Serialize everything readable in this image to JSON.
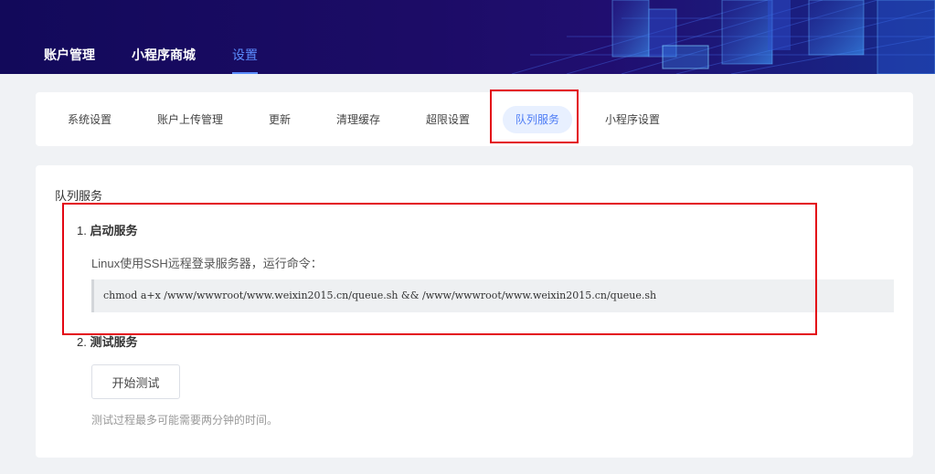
{
  "header": {
    "nav": [
      {
        "label": "账户管理"
      },
      {
        "label": "小程序商城"
      },
      {
        "label": "设置"
      }
    ],
    "active_index": 2,
    "accent_color": "#5b8cff"
  },
  "tabs": {
    "items": [
      {
        "label": "系统设置"
      },
      {
        "label": "账户上传管理"
      },
      {
        "label": "更新"
      },
      {
        "label": "清理缓存"
      },
      {
        "label": "超限设置"
      },
      {
        "label": "队列服务"
      },
      {
        "label": "小程序设置"
      }
    ],
    "active_index": 5
  },
  "queue": {
    "title": "队列服务",
    "step1": {
      "number": "1.",
      "title": "启动服务"
    },
    "step1_desc": "Linux使用SSH远程登录服务器，运行命令：",
    "command": "chmod a+x /www/wwwroot/www.weixin2015.cn/queue.sh && /www/wwwroot/www.weixin2015.cn/queue.sh",
    "step2": {
      "number": "2.",
      "title": "测试服务"
    },
    "test_button": "开始测试",
    "hint": "测试过程最多可能需要两分钟的时间。"
  },
  "highlight_color": "#e30613"
}
